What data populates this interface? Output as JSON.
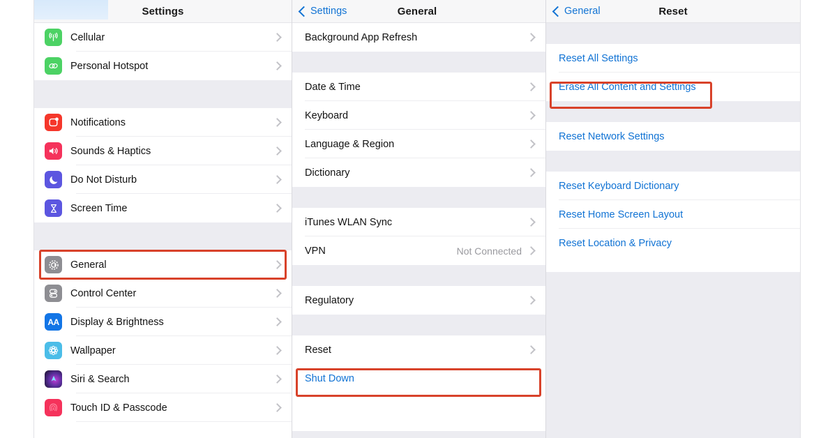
{
  "screen": {
    "accent_blue": "#1173d4",
    "highlight_red": "#d8422a",
    "group_bg": "#ececf1"
  },
  "settings_panel": {
    "title": "Settings",
    "groups": [
      {
        "items": [
          {
            "label": "Cellular",
            "icon": "cellular-icon",
            "icon_color": "#4cd264",
            "chevron": true
          },
          {
            "label": "Personal Hotspot",
            "icon": "hotspot-icon",
            "icon_color": "#4cd264",
            "chevron": true
          }
        ]
      },
      {
        "items": [
          {
            "label": "Notifications",
            "icon": "notifications-icon",
            "icon_color": "#f5372b",
            "chevron": true
          },
          {
            "label": "Sounds & Haptics",
            "icon": "sounds-icon",
            "icon_color": "#f5325b",
            "chevron": true
          },
          {
            "label": "Do Not Disturb",
            "icon": "moon-icon",
            "icon_color": "#5c56e0",
            "chevron": true
          },
          {
            "label": "Screen Time",
            "icon": "hourglass-icon",
            "icon_color": "#5c56e0",
            "chevron": true
          }
        ]
      },
      {
        "items": [
          {
            "label": "General",
            "icon": "gear-icon",
            "icon_color": "#8e8e93",
            "chevron": true,
            "highlighted": true
          },
          {
            "label": "Control Center",
            "icon": "control-center-icon",
            "icon_color": "#8e8e93",
            "chevron": true
          },
          {
            "label": "Display & Brightness",
            "icon": "display-icon",
            "icon_color": "#1275e6",
            "chevron": true
          },
          {
            "label": "Wallpaper",
            "icon": "wallpaper-icon",
            "icon_color": "#4bbde8",
            "chevron": true
          },
          {
            "label": "Siri & Search",
            "icon": "siri-icon",
            "icon_color": "#2b1b42",
            "chevron": true
          },
          {
            "label": "Touch ID & Passcode",
            "icon": "touchid-icon",
            "icon_color": "#f5325b",
            "chevron": true
          }
        ]
      }
    ]
  },
  "general_panel": {
    "back_label": "Settings",
    "title": "General",
    "groups": [
      {
        "items": [
          {
            "label": "Background App Refresh",
            "chevron": true
          }
        ]
      },
      {
        "items": [
          {
            "label": "Date & Time",
            "chevron": true
          },
          {
            "label": "Keyboard",
            "chevron": true
          },
          {
            "label": "Language & Region",
            "chevron": true
          },
          {
            "label": "Dictionary",
            "chevron": true
          }
        ]
      },
      {
        "items": [
          {
            "label": "iTunes WLAN Sync",
            "chevron": true
          },
          {
            "label": "VPN",
            "value": "Not Connected",
            "chevron": true
          }
        ]
      },
      {
        "items": [
          {
            "label": "Regulatory",
            "chevron": true
          }
        ]
      },
      {
        "items": [
          {
            "label": "Reset",
            "chevron": true,
            "highlighted": true
          },
          {
            "label": "Shut Down",
            "link": true,
            "chevron": false
          }
        ]
      }
    ]
  },
  "reset_panel": {
    "back_label": "General",
    "title": "Reset",
    "groups": [
      {
        "items": [
          {
            "label": "Reset All Settings",
            "link": true
          },
          {
            "label": "Erase All Content and Settings",
            "link": true,
            "highlighted": true
          }
        ]
      },
      {
        "items": [
          {
            "label": "Reset Network Settings",
            "link": true
          }
        ]
      },
      {
        "items": [
          {
            "label": "Reset Keyboard Dictionary",
            "link": true
          },
          {
            "label": "Reset Home Screen Layout",
            "link": true
          },
          {
            "label": "Reset Location & Privacy",
            "link": true
          }
        ]
      }
    ]
  }
}
